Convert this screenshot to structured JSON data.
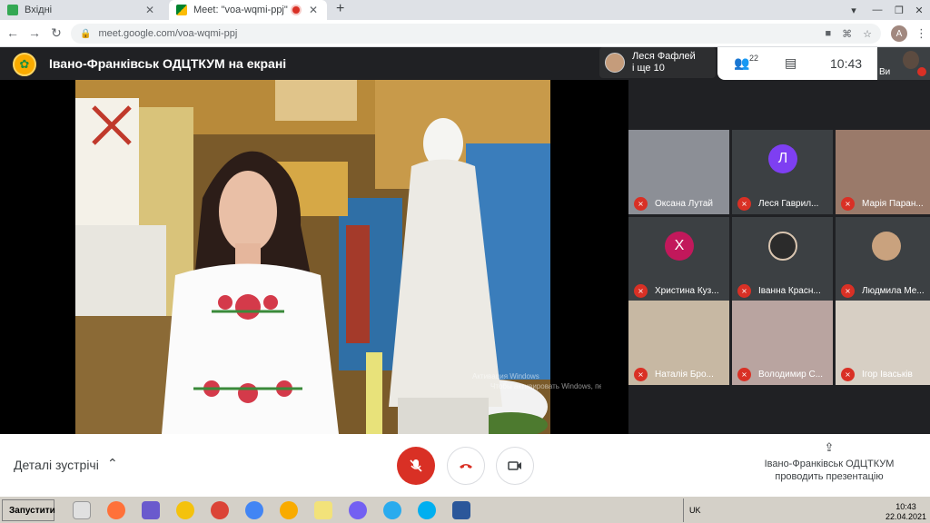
{
  "browser": {
    "tabs": [
      {
        "title": "Вхідні",
        "active": false
      },
      {
        "title": "Meet: \"voa-wqmi-ppj\"",
        "active": true
      }
    ],
    "url": "meet.google.com/voa-wqmi-ppj",
    "profile_initial": "A"
  },
  "meet": {
    "presentation_title": "Івано-Франківськ ОДЦТКУМ на екрані",
    "participants_chip": {
      "line1": "Леся Фафлей",
      "line2": "і ще 10"
    },
    "people_count": "22",
    "clock": "10:43",
    "self_label": "Ви",
    "watermark_line1": "Активация Windows",
    "watermark_line2": "Чтобы активировать Windows, перейдите в раздел \"Настройки\", щоб",
    "participants": [
      {
        "name": "Оксана Лутай",
        "type": "video",
        "bg": "#8c8f96"
      },
      {
        "name": "Леся Гаврил...",
        "type": "initial",
        "initial": "Л",
        "color": "#7e3ff2"
      },
      {
        "name": "Марія Паран...",
        "type": "video",
        "bg": "#9a7a6a"
      },
      {
        "name": "Христина Куз...",
        "type": "initial",
        "initial": "Х",
        "color": "#c2185b"
      },
      {
        "name": "Іванна Красн...",
        "type": "photo",
        "bg": "#2b2b2b"
      },
      {
        "name": "Людмила Ме...",
        "type": "photo",
        "bg": "#c9a27e"
      },
      {
        "name": "Наталія Бро...",
        "type": "video",
        "bg": "#c7b8a3"
      },
      {
        "name": "Володимир С...",
        "type": "video",
        "bg": "#b9a4a0"
      },
      {
        "name": "Ігор Іваськів",
        "type": "video",
        "bg": "#d7cfc4"
      }
    ]
  },
  "controls": {
    "details_label": "Деталі зустрічі",
    "presenting_line1": "Івано-Франківськ ОДЦТКУМ",
    "presenting_line2": "проводить презентацію"
  },
  "taskbar": {
    "start_label": "Запустити",
    "lang": "UK",
    "time": "10:43",
    "date": "22.04.2021"
  }
}
